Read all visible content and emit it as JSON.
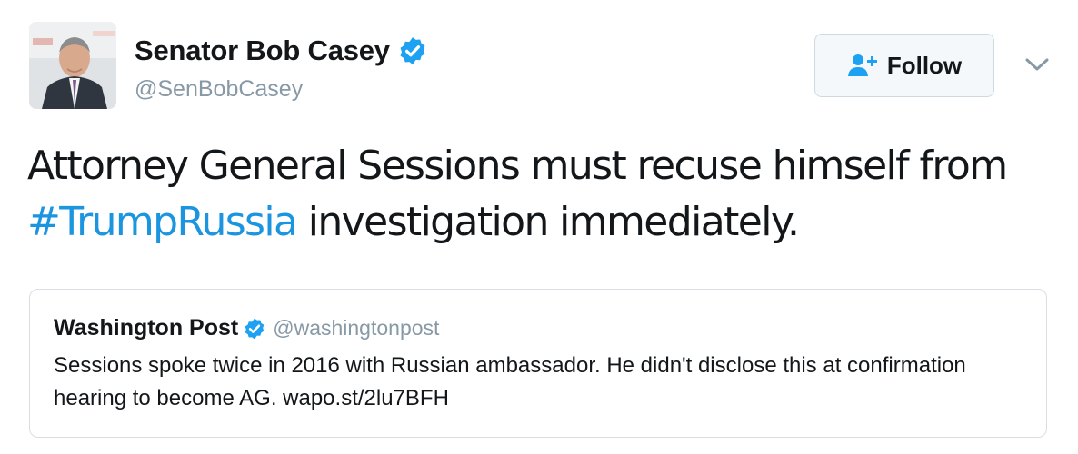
{
  "author": {
    "display_name": "Senator Bob Casey",
    "handle": "@SenBobCasey",
    "verified_icon": "verified-badge-icon",
    "avatar_icon": "profile-photo"
  },
  "follow_button": {
    "label": "Follow",
    "icon": "add-user-icon"
  },
  "menu_caret": {
    "icon": "chevron-down-icon"
  },
  "tweet": {
    "text_before": "Attorney General Sessions must recuse himself from ",
    "hashtag": "#TrumpRussia",
    "text_after": " investigation immediately."
  },
  "quoted_tweet": {
    "display_name": "Washington Post",
    "handle": "@washingtonpost",
    "text": "Sessions spoke twice in 2016 with Russian ambassador. He didn't disclose this at confirmation hearing to become AG. wapo.st/2lu7BFH"
  },
  "colors": {
    "link": "#1b95e0",
    "verified": "#1da1f2",
    "secondary_text": "#8899a6",
    "primary_text": "#14171a"
  }
}
